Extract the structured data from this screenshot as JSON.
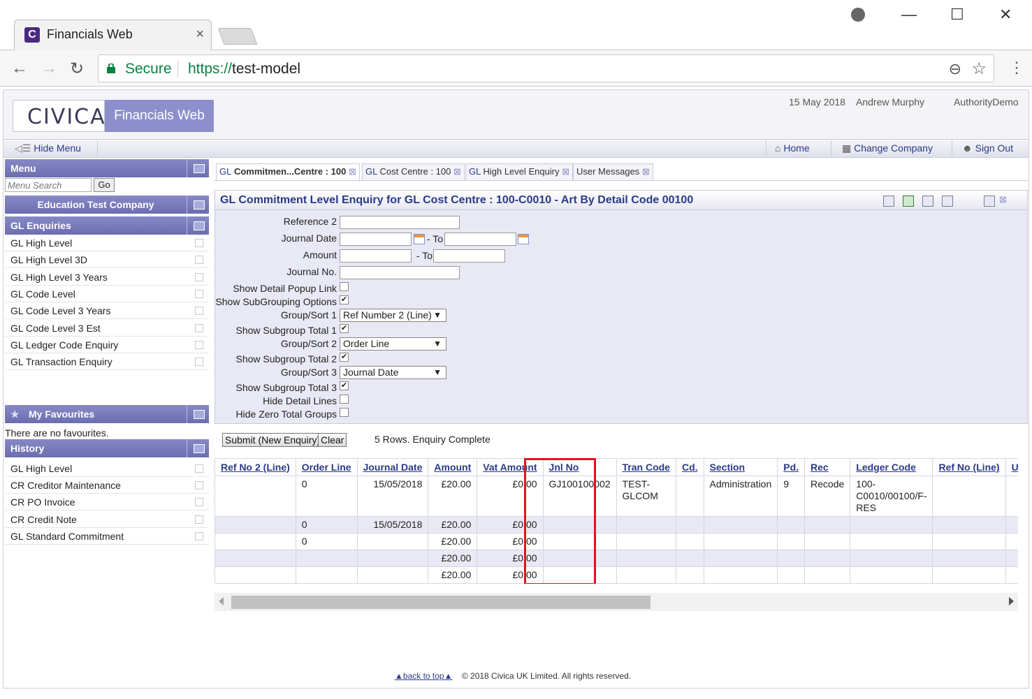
{
  "browser": {
    "tab_title": "Financials Web",
    "favicon_letter": "C",
    "tab_close": "×",
    "secure_label": "Secure",
    "url_protocol": "https://",
    "url_host": "test-model"
  },
  "header": {
    "logo": "CIVICA",
    "product": "Financials Web",
    "date": "15 May 2018",
    "user": "Andrew Murphy",
    "company": "AuthorityDemo"
  },
  "menubar": {
    "hide_menu": "Hide Menu",
    "home": "Home",
    "change_company": "Change Company",
    "sign_out": "Sign Out"
  },
  "sidebar": {
    "menu_title": "Menu",
    "search_placeholder": "Menu Search",
    "go_label": "Go",
    "company_title": "Education Test Company",
    "enquiries_title": "GL Enquiries",
    "enquiries": [
      "GL High Level",
      "GL High Level 3D",
      "GL High Level 3 Years",
      "GL Code Level",
      "GL Code Level 3 Years",
      "GL Code Level 3 Est",
      "GL Ledger Code Enquiry",
      "GL Transaction Enquiry"
    ],
    "favourites_title": "My Favourites",
    "no_favourites": "There are no favourites.",
    "history_title": "History",
    "history": [
      "GL High Level",
      "CR Creditor Maintenance",
      "CR PO Invoice",
      "CR Credit Note",
      "GL Standard Commitment"
    ]
  },
  "tabs": [
    {
      "abbr": "GL",
      "label": " Commitmen...Centre : 100"
    },
    {
      "abbr": "GL",
      "label": " Cost Centre : 100"
    },
    {
      "abbr": "GL",
      "label": " High Level Enquiry"
    },
    {
      "abbr": "",
      "label": "User Messages"
    }
  ],
  "enquiry": {
    "title": "GL Commitment Level Enquiry for GL Cost Centre : 100-C0010 - Art By Detail Code 00100",
    "labels": {
      "reference2": "Reference 2",
      "journal_date": "Journal Date",
      "amount": "Amount",
      "journal_no": "Journal No.",
      "show_detail_popup": "Show Detail Popup Link",
      "show_subgrouping": "Show SubGrouping Options",
      "group_sort_1": "Group/Sort 1",
      "show_subtotal_1": "Show Subgroup Total 1",
      "group_sort_2": "Group/Sort 2",
      "show_subtotal_2": "Show Subgroup Total 2",
      "group_sort_3": "Group/Sort 3",
      "show_subtotal_3": "Show Subgroup Total 3",
      "hide_detail_lines": "Hide Detail Lines",
      "hide_zero_totals": "Hide Zero Total Groups",
      "to": "- To"
    },
    "selects": {
      "group_sort_1": "Ref Number 2 (Line)",
      "group_sort_2": "Order Line",
      "group_sort_3": "Journal Date"
    },
    "checks": {
      "show_detail_popup": false,
      "show_subgrouping": true,
      "show_subtotal_1": true,
      "show_subtotal_2": true,
      "show_subtotal_3": true,
      "hide_detail_lines": false,
      "hide_zero_totals": false
    },
    "check_mark": "✔",
    "submit_label": "Submit (New Enquiry)",
    "clear_label": "Clear",
    "status": "5 Rows. Enquiry Complete"
  },
  "results": {
    "columns": [
      "Ref No 2 (Line)",
      "Order Line",
      "Journal Date",
      "Amount",
      "Vat Amount",
      "Jnl No",
      "Tran Code",
      "Cd.",
      "Section",
      "Pd.",
      "Rec",
      "Ledger Code",
      "Ref No (Line)",
      "User Analysis"
    ],
    "rows": [
      {
        "ref2": "",
        "order_line": "0",
        "journal_date": "15/05/2018",
        "amount": "£20.00",
        "vat": "£0.00",
        "jnl_no": "GJ100100002",
        "tran_code": "TEST-GLCOM",
        "cd": "",
        "section": "Administration",
        "pd": "9",
        "rec": "Recode",
        "ledger": "100-C0010/00100/F-RES",
        "refno": "",
        "user": ""
      },
      {
        "ref2": "",
        "order_line": "0",
        "journal_date": "15/05/2018",
        "amount": "£20.00",
        "vat": "£0.00",
        "jnl_no": "",
        "tran_code": "",
        "cd": "",
        "section": "",
        "pd": "",
        "rec": "",
        "ledger": "",
        "refno": "",
        "user": ""
      },
      {
        "ref2": "",
        "order_line": "0",
        "journal_date": "",
        "amount": "£20.00",
        "vat": "£0.00",
        "jnl_no": "",
        "tran_code": "",
        "cd": "",
        "section": "",
        "pd": "",
        "rec": "",
        "ledger": "",
        "refno": "",
        "user": ""
      },
      {
        "ref2": "",
        "order_line": "",
        "journal_date": "",
        "amount": "£20.00",
        "vat": "£0.00",
        "jnl_no": "",
        "tran_code": "",
        "cd": "",
        "section": "",
        "pd": "",
        "rec": "",
        "ledger": "",
        "refno": "",
        "user": ""
      },
      {
        "ref2": "",
        "order_line": "",
        "journal_date": "",
        "amount": "£20.00",
        "vat": "£0.00",
        "jnl_no": "",
        "tran_code": "",
        "cd": "",
        "section": "",
        "pd": "",
        "rec": "",
        "ledger": "",
        "refno": "",
        "user": ""
      }
    ]
  },
  "footer": {
    "back_to_top": "back to top",
    "copyright": "© 2018 Civica UK Limited. All rights reserved."
  },
  "colors": {
    "accent": "#6b6db0",
    "link": "#2a3a8a",
    "highlight": "#e0141e",
    "form_bg": "#e8e9f4"
  }
}
